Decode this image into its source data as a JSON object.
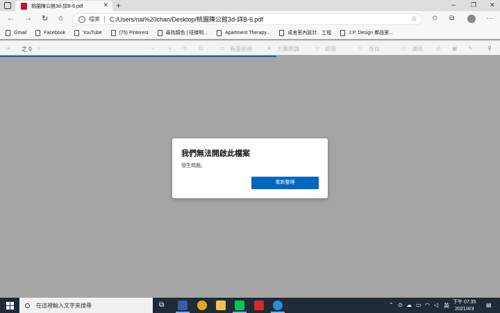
{
  "browser": {
    "tab_title": "桃園陳公館3d-詳B-6.pdf",
    "tab_close": "✕",
    "new_tab": "+",
    "address_scheme": "檔案",
    "address_url": "C:/Users/nai%20chan/Desktop/桃園陳公館3d-詳B-6.pdf"
  },
  "bookmarks": [
    {
      "label": "Gmail"
    },
    {
      "label": "Facebook"
    },
    {
      "label": "YouTube"
    },
    {
      "label": "(75) Pinterest"
    },
    {
      "label": "尋找顏色 | 班傑明..."
    },
    {
      "label": "Apartment Therapy..."
    },
    {
      "label": "成舍室內設計．工程"
    },
    {
      "label": "J.P. Design 都品室..."
    }
  ],
  "pdf_toolbar": {
    "page_count": "之 0",
    "page_view": "頁面檢視",
    "read_aloud": "大聲朗讀",
    "draw": "繪圖",
    "highlight": "反白",
    "erase": "清除"
  },
  "dialog": {
    "title": "我們無法開啟此檔案",
    "message": "發生問題。",
    "button": "重新整理"
  },
  "taskbar": {
    "search_placeholder": "在這裡輸入文字來搜尋",
    "ime": "英",
    "time": "下午 07:35",
    "date": "2021/4/3"
  }
}
